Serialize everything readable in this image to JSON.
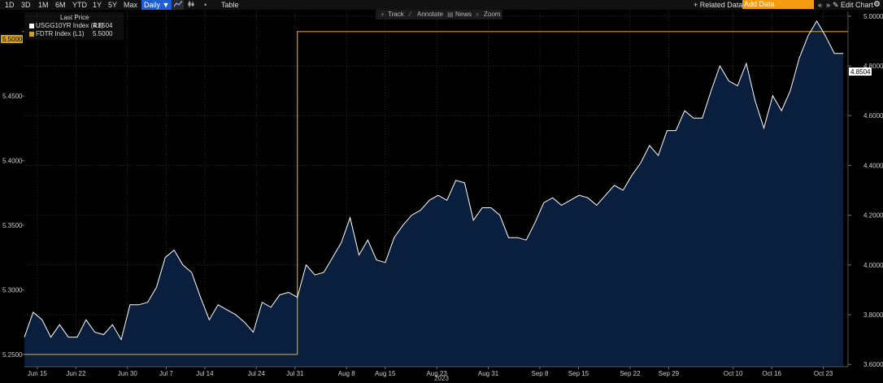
{
  "toolbar": {
    "periods": [
      "1D",
      "3D",
      "1M",
      "6M",
      "YTD",
      "1Y",
      "5Y",
      "Max"
    ],
    "frequency": "Daily",
    "frequency_arrow": "▼",
    "line_icon": "line-chart-icon",
    "bar_icon": "candlestick-icon",
    "more": "•",
    "table": "Table",
    "related_label": "+ Related Data",
    "add_data_placeholder": "Add Data",
    "edit_chart": "✎ Edit Chart",
    "settings_icon": "gear-icon",
    "nav_prev": "«",
    "nav_next": "»"
  },
  "chart_tools": {
    "track": "Track",
    "annotate": "Annotate",
    "news": "News",
    "zoom": "Zoom"
  },
  "legend": {
    "header": "Last Price",
    "series": [
      {
        "name": "USGG10YR Index (R1)",
        "value": "4.8504",
        "color": "#ffffff"
      },
      {
        "name": "FDTR Index (L1)",
        "value": "5.5000",
        "color": "#d4a017"
      }
    ]
  },
  "chart_data": {
    "type": "line",
    "left_axis": {
      "ticks": [
        "5.2500",
        "5.3000",
        "5.3500",
        "5.4000",
        "5.4500",
        "5.5000"
      ],
      "range": [
        5.2404,
        5.5156
      ]
    },
    "right_axis": {
      "ticks": [
        "3.6000",
        "3.8000",
        "4.0000",
        "4.2000",
        "4.4000",
        "4.6000",
        "4.8000",
        "5.0000"
      ],
      "range": [
        3.591,
        5.019
      ]
    },
    "left_marker": "5.5000",
    "right_marker": "4.8504",
    "year_label": "2023",
    "x_ticks": [
      "Jun 15",
      "Jun 22",
      "Jun 30",
      "Jul 7",
      "Jul 14",
      "Jul 24",
      "Jul 31",
      "Aug 8",
      "Aug 15",
      "Aug 23",
      "Aug 31",
      "Sep 8",
      "Sep 15",
      "Sep 22",
      "Sep 29",
      "Oct 10",
      "Oct 16",
      "Oct 23"
    ],
    "x_tick_index": [
      1,
      4,
      8,
      11,
      14,
      18,
      21,
      25,
      28,
      32,
      36,
      40,
      43,
      47,
      50,
      55,
      58,
      62
    ],
    "series": [
      {
        "name": "USGG10YR Index (R1)",
        "axis": "right",
        "color": "#ffffff",
        "style": "area",
        "values": [
          3.71,
          3.81,
          3.78,
          3.71,
          3.76,
          3.71,
          3.71,
          3.78,
          3.73,
          3.72,
          3.76,
          3.7,
          3.84,
          3.84,
          3.85,
          3.91,
          4.03,
          4.06,
          4.0,
          3.97,
          3.87,
          3.78,
          3.84,
          3.82,
          3.8,
          3.77,
          3.73,
          3.85,
          3.83,
          3.88,
          3.89,
          3.87,
          4.0,
          3.96,
          3.97,
          4.03,
          4.09,
          4.19,
          4.04,
          4.1,
          4.02,
          4.01,
          4.11,
          4.16,
          4.2,
          4.22,
          4.26,
          4.28,
          4.26,
          4.34,
          4.33,
          4.18,
          4.23,
          4.23,
          4.2,
          4.11,
          4.11,
          4.1,
          4.17,
          4.25,
          4.27,
          4.24,
          4.26,
          4.28,
          4.27,
          4.24,
          4.28,
          4.32,
          4.3,
          4.36,
          4.41,
          4.48,
          4.44,
          4.54,
          4.54,
          4.62,
          4.59,
          4.59,
          4.7,
          4.8,
          4.74,
          4.72,
          4.81,
          4.66,
          4.55,
          4.68,
          4.62,
          4.7,
          4.83,
          4.92,
          4.98,
          4.92,
          4.85,
          4.85
        ]
      },
      {
        "name": "FDTR Index (L1)",
        "axis": "left",
        "color": "#d4a017",
        "style": "step",
        "values": [
          5.25,
          5.25,
          5.25,
          5.25,
          5.25,
          5.25,
          5.25,
          5.25,
          5.25,
          5.25,
          5.25,
          5.25,
          5.25,
          5.25,
          5.25,
          5.25,
          5.25,
          5.25,
          5.25,
          5.25,
          5.25,
          5.25,
          5.25,
          5.25,
          5.25,
          5.25,
          5.25,
          5.25,
          5.25,
          5.25,
          5.25,
          5.5,
          5.5,
          5.5,
          5.5,
          5.5,
          5.5,
          5.5,
          5.5,
          5.5,
          5.5,
          5.5,
          5.5,
          5.5,
          5.5,
          5.5,
          5.5,
          5.5,
          5.5,
          5.5,
          5.5,
          5.5,
          5.5,
          5.5,
          5.5,
          5.5,
          5.5,
          5.5,
          5.5,
          5.5,
          5.5,
          5.5,
          5.5,
          5.5,
          5.5,
          5.5,
          5.5,
          5.5,
          5.5,
          5.5,
          5.5,
          5.5,
          5.5,
          5.5,
          5.5,
          5.5,
          5.5,
          5.5,
          5.5,
          5.5,
          5.5,
          5.5,
          5.5,
          5.5,
          5.5,
          5.5,
          5.5,
          5.5,
          5.5,
          5.5,
          5.5,
          5.5,
          5.5,
          5.5
        ]
      }
    ],
    "grid": true,
    "legend_position": "top-left"
  }
}
